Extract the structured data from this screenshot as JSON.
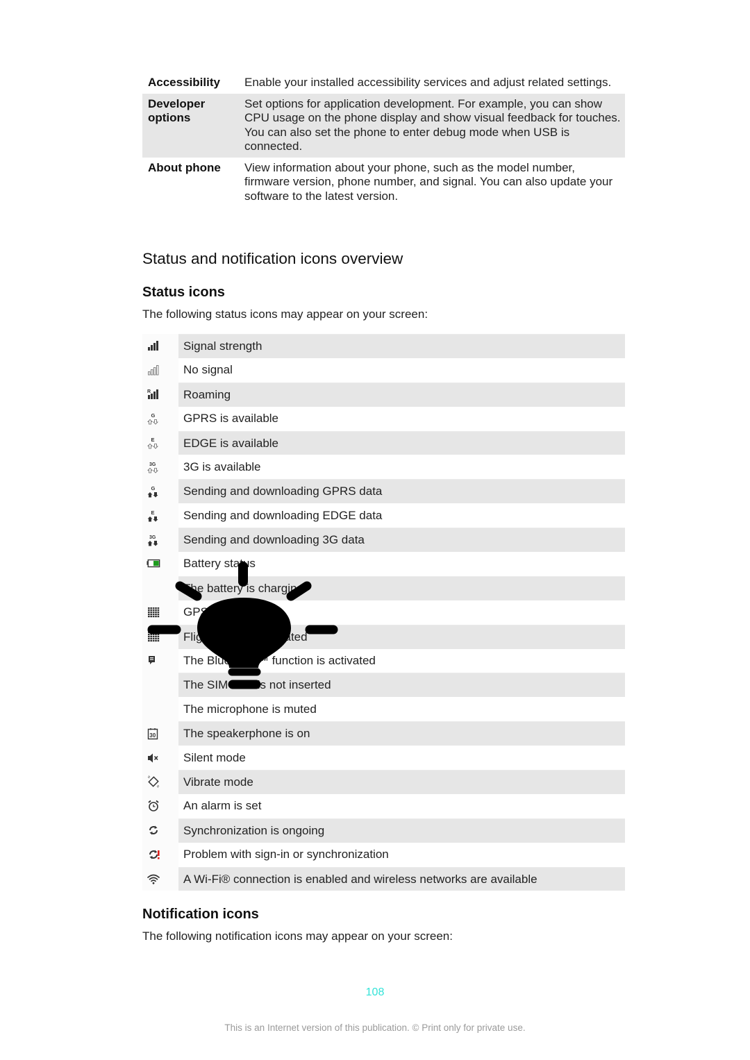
{
  "settings_table": [
    {
      "term": "Accessibility",
      "description": "Enable your installed accessibility services and adjust related settings.",
      "shaded": false
    },
    {
      "term": "Developer options",
      "description": "Set options for application development. For example, you can show CPU usage on the phone display and show visual feedback for touches. You can also set the phone to enter debug mode when USB is connected.",
      "shaded": true
    },
    {
      "term": "About phone",
      "description": "View information about your phone, such as the model number, firmware version, phone number, and signal. You can also update your software to the latest version.",
      "shaded": false
    }
  ],
  "section_title": "Status and notification icons overview",
  "status_icons": {
    "heading": "Status icons",
    "intro": "The following status icons may appear on your screen:",
    "rows": [
      {
        "icon": "signal-strength-icon",
        "label": "Signal strength"
      },
      {
        "icon": "no-signal-icon",
        "label": "No signal"
      },
      {
        "icon": "roaming-icon",
        "label": "Roaming"
      },
      {
        "icon": "gprs-available-icon",
        "label": "GPRS is available"
      },
      {
        "icon": "edge-available-icon",
        "label": "EDGE is available"
      },
      {
        "icon": "3g-available-icon",
        "label": "3G is available"
      },
      {
        "icon": "gprs-data-icon",
        "label": "Sending and downloading GPRS data"
      },
      {
        "icon": "edge-data-icon",
        "label": "Sending and downloading EDGE data"
      },
      {
        "icon": "3g-data-icon",
        "label": "Sending and downloading 3G data"
      },
      {
        "icon": "battery-status-icon",
        "label": "Battery status"
      },
      {
        "icon": "",
        "label": "The battery is charging"
      },
      {
        "icon": "gps-icon",
        "label": "GPS is activated"
      },
      {
        "icon": "flight-mode-icon",
        "label": "Flight mode is activated"
      },
      {
        "icon": "bluetooth-icon",
        "label": "The Bluetooth™ function is activated"
      },
      {
        "icon": "",
        "label": "The SIM card is not inserted"
      },
      {
        "icon": "",
        "label": "The microphone is muted"
      },
      {
        "icon": "speakerphone-icon",
        "label": "The speakerphone is on"
      },
      {
        "icon": "silent-mode-icon",
        "label": "Silent mode"
      },
      {
        "icon": "vibrate-mode-icon",
        "label": "Vibrate mode"
      },
      {
        "icon": "alarm-icon",
        "label": "An alarm is set"
      },
      {
        "icon": "sync-icon",
        "label": "Synchronization is ongoing"
      },
      {
        "icon": "sync-problem-icon",
        "label": "Problem with sign-in or synchronization"
      },
      {
        "icon": "wifi-icon",
        "label": "A Wi-Fi® connection is enabled and wireless networks are available"
      }
    ]
  },
  "notification_icons": {
    "heading": "Notification icons",
    "intro": "The following notification icons may appear on your screen:"
  },
  "page_number": "108",
  "footer": "This is an Internet version of this publication. © Print only for private use.",
  "colors": {
    "page_number": "#33e3d8",
    "row_shade": "#e6e6e6",
    "battery_green": "#1e9c1e",
    "sync_problem_red": "#e0201c"
  }
}
